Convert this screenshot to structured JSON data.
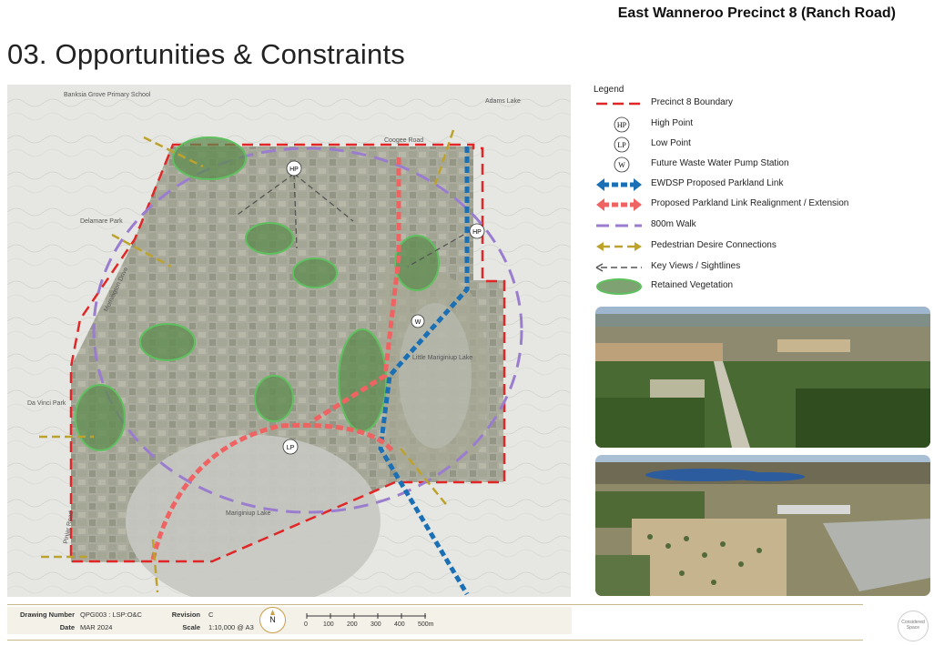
{
  "header": {
    "project": "East Wanneroo Precinct 8 (Ranch Road)",
    "title": "03. Opportunities & Constraints"
  },
  "map": {
    "labels": {
      "banksia": "Banksia Grove Primary School",
      "adams": "Adams Lake",
      "coogee": "Coogee Road",
      "delamare": "Delamare Park",
      "mornington": "Mornington Drive",
      "davinci": "Da Vinci Park",
      "little_mariginiup": "Little Mariginiup Lake",
      "mariginiup": "Mariginiup Lake",
      "pinjar": "Pinjar Road"
    },
    "markers": {
      "hp": "HP",
      "lp": "LP",
      "w": "W"
    }
  },
  "legend": {
    "title": "Legend",
    "items": [
      {
        "symbol": "boundary",
        "label": "Precinct 8 Boundary",
        "color": "#e02626"
      },
      {
        "symbol": "HP",
        "label": "High Point"
      },
      {
        "symbol": "LP",
        "label": "Low Point"
      },
      {
        "symbol": "W",
        "label": "Future Waste Water Pump Station"
      },
      {
        "symbol": "ewdsp-link",
        "label": "EWDSP Proposed Parkland Link",
        "color": "#1a6fb5"
      },
      {
        "symbol": "parkland-realignment",
        "label": "Proposed Parkland Link Realignment / Extension",
        "color": "#ef6363"
      },
      {
        "symbol": "walk",
        "label": "800m Walk",
        "color": "#9b7dd0"
      },
      {
        "symbol": "pedestrian",
        "label": "Pedestrian Desire Connections",
        "color": "#bda22c"
      },
      {
        "symbol": "views",
        "label": "Key Views / Sightlines",
        "color": "#555555"
      },
      {
        "symbol": "vegetation",
        "label": "Retained Vegetation",
        "color": "#4caf50"
      }
    ]
  },
  "footer": {
    "drawing_number_key": "Drawing Number",
    "drawing_number": "QPG003 : LSP:O&C",
    "date_key": "Date",
    "date": "MAR 2024",
    "revision_key": "Revision",
    "revision": "C",
    "scale_key": "Scale",
    "scale": "1:10,000 @ A3",
    "north": "N",
    "scale_ticks": [
      "0",
      "100",
      "200",
      "300",
      "400",
      "500m"
    ],
    "logo": "Considered Space"
  }
}
